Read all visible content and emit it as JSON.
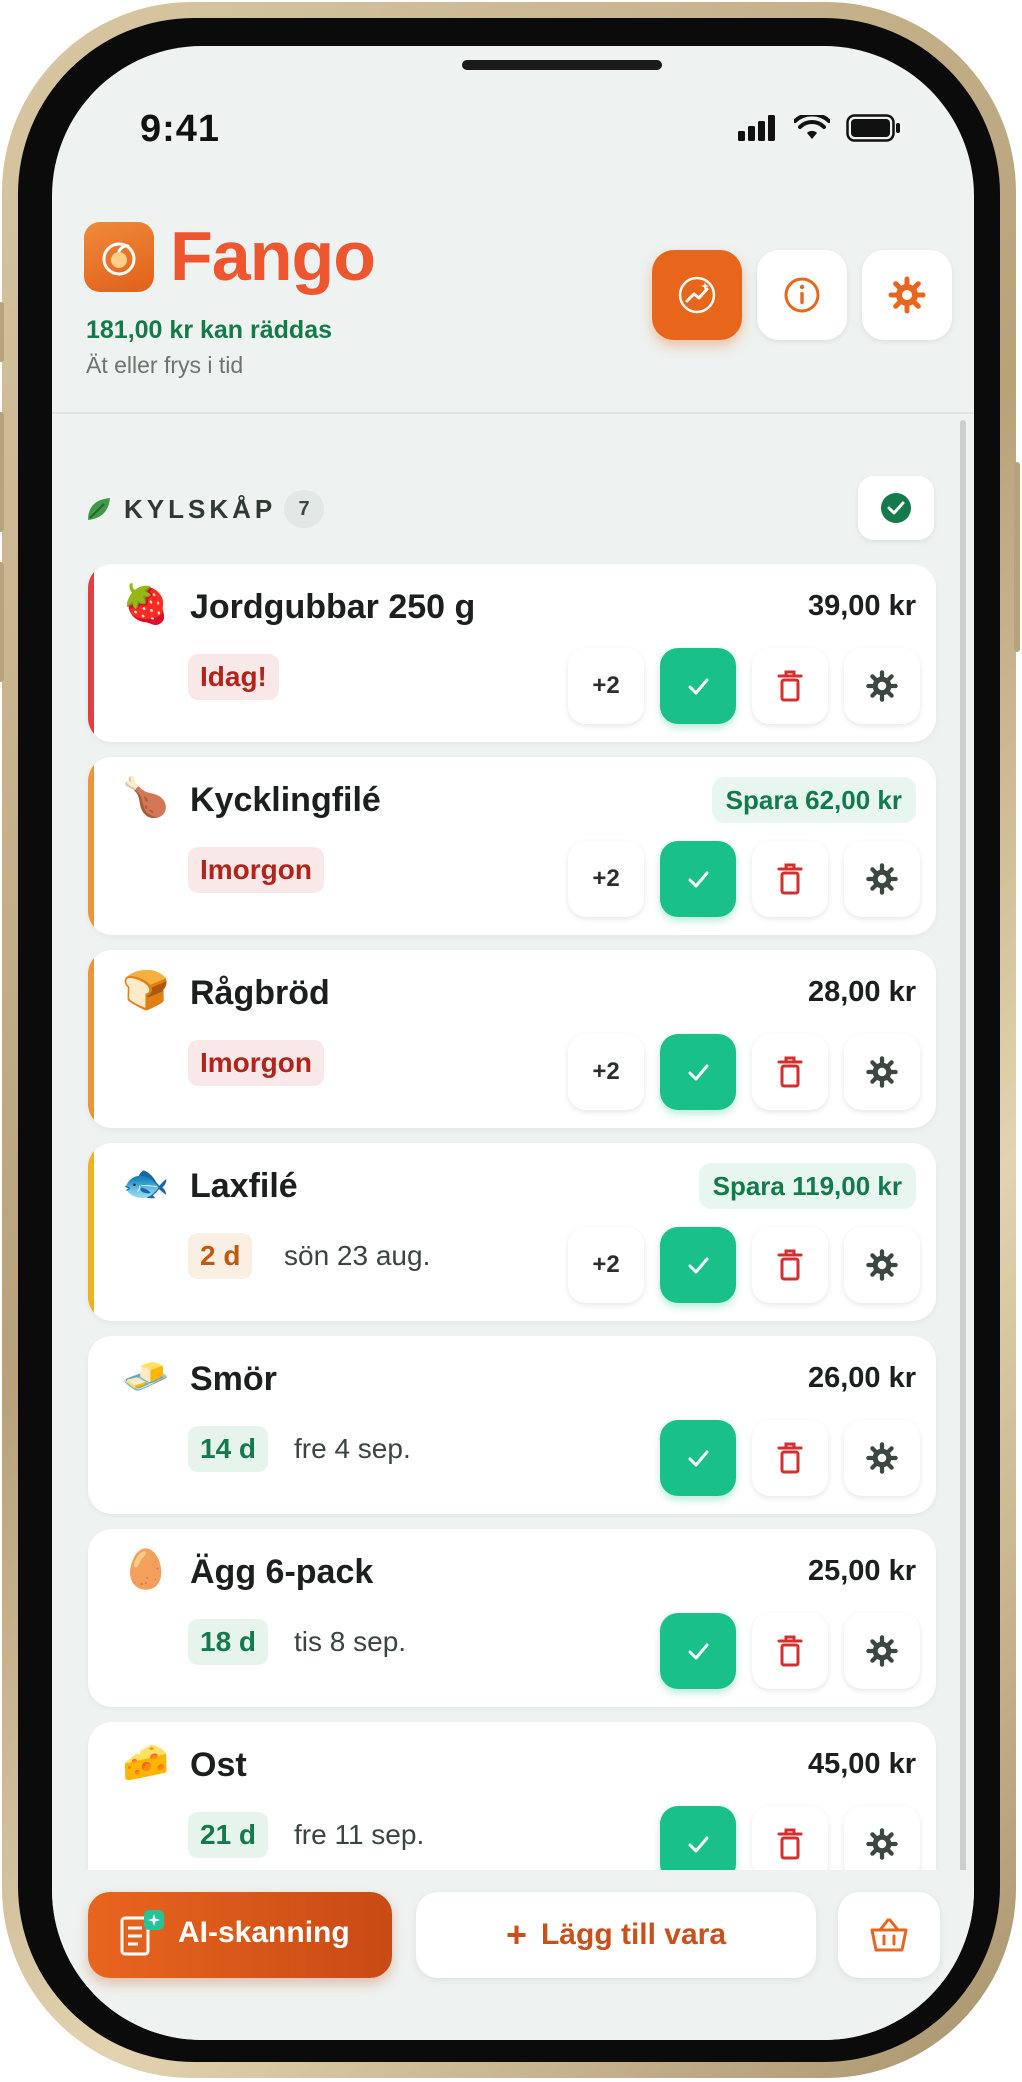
{
  "status_bar": {
    "time": "9:41"
  },
  "header": {
    "brand": "Fango",
    "savings": "181,00 kr kan räddas",
    "subtitle": "Ät eller frys i tid",
    "buttons": [
      "trend-icon",
      "info-icon",
      "gear-icon"
    ]
  },
  "section": {
    "title": "KYLSKÅP",
    "count": "7"
  },
  "items": [
    {
      "emoji": "🍓",
      "name": "Jordgubbar 250 g",
      "price": "39,00 kr",
      "badge": "Idag!",
      "badge_color": "red",
      "date": "",
      "plus": "+2",
      "stripe": "#e04040"
    },
    {
      "emoji": "🍗",
      "name": "Kycklingfilé",
      "save": "Spara 62,00 kr",
      "badge": "Imorgon",
      "badge_color": "red",
      "date": "",
      "plus": "+2",
      "stripe": "#f0923a"
    },
    {
      "emoji": "🍞",
      "name": "Rågbröd",
      "price": "28,00 kr",
      "badge": "Imorgon",
      "badge_color": "red",
      "date": "",
      "plus": "+2",
      "stripe": "#f0923a"
    },
    {
      "emoji": "🐟",
      "name": "Laxfilé",
      "save": "Spara 119,00 kr",
      "badge": "2 d",
      "badge_color": "orange",
      "date": "sön 23 aug.",
      "plus": "+2",
      "stripe": "#f0b020"
    },
    {
      "emoji": "🧈",
      "name": "Smör",
      "price": "26,00 kr",
      "badge": "14 d",
      "badge_color": "green",
      "date": "fre 4 sep.",
      "plus": ""
    },
    {
      "emoji": "🥚",
      "name": "Ägg 6-pack",
      "price": "25,00 kr",
      "badge": "18 d",
      "badge_color": "green",
      "date": "tis 8 sep.",
      "plus": ""
    },
    {
      "emoji": "🧀",
      "name": "Ost",
      "price": "45,00 kr",
      "badge": "21 d",
      "badge_color": "green",
      "date": "fre 11 sep.",
      "plus": ""
    }
  ],
  "bottom_bar": {
    "ai_label": "AI-skanning",
    "add_label": "Lägg till vara",
    "add_icon": "+",
    "basket_icon": "basket-icon"
  },
  "colors": {
    "accent": "#e8661c",
    "brand": "#ee5630",
    "check": "#19c08a",
    "delete": "#d32f2f",
    "savings": "#157a4a"
  }
}
